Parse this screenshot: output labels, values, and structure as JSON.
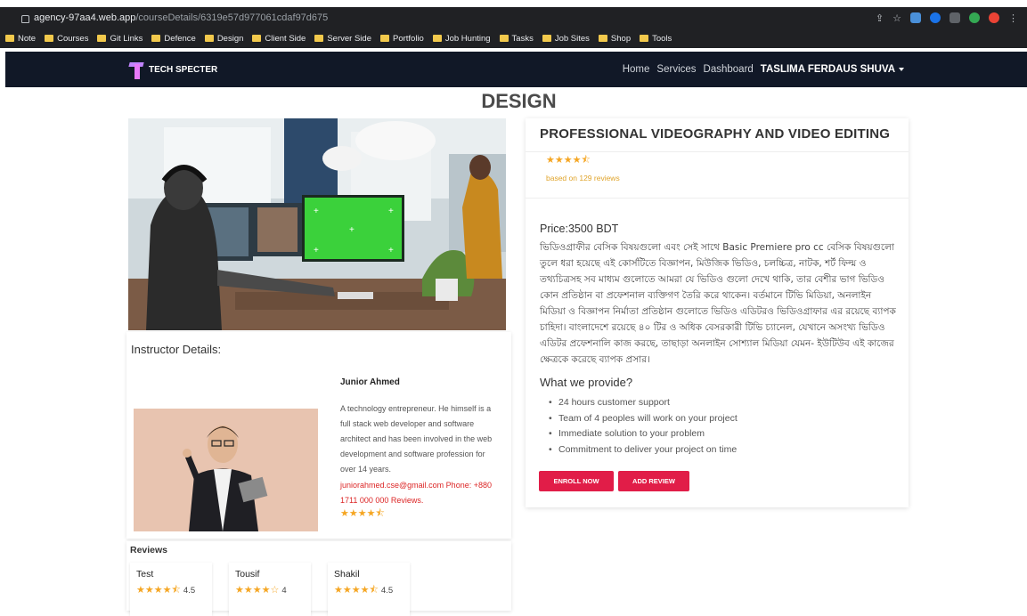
{
  "browser": {
    "url_host": "agency-97aa4.web.app",
    "url_path": "/courseDetails/6319e57d977061cdaf97d675",
    "bookmarks": [
      "Note",
      "Courses",
      "Git Links",
      "Defence",
      "Design",
      "Client Side",
      "Server Side",
      "Portfolio",
      "Job Hunting",
      "Tasks",
      "Job Sites",
      "Shop",
      "Tools"
    ]
  },
  "navbar": {
    "brand": "TECH SPECTER",
    "links": [
      "Home",
      "Services",
      "Dashboard"
    ],
    "user": "TASLIMA FERDAUS SHUVA"
  },
  "page": {
    "title": "DESIGN"
  },
  "instructor": {
    "heading": "Instructor Details:",
    "name": "Junior Ahmed",
    "bio": "A technology entrepreneur. He himself is a full stack web developer and software architect and has been involved in the web development and software profession for over 14 years.",
    "contact": "juniorahmed.cse@gmail.com Phone: +880 1711 000 000 Reviews.",
    "rating": 4.5
  },
  "reviews": {
    "heading": "Reviews",
    "items": [
      {
        "name": "Test",
        "rating": 4.5,
        "rating_text": "4.5"
      },
      {
        "name": "Tousif",
        "rating": 4,
        "rating_text": "4"
      },
      {
        "name": "Shakil",
        "rating": 4.5,
        "rating_text": "4.5"
      }
    ]
  },
  "course": {
    "title": "PROFESSIONAL VIDEOGRAPHY AND VIDEO EDITING",
    "rating": 4.5,
    "reviews_count": "based on 129 reviews",
    "price": "Price:3500 BDT",
    "description": "ভিডিওগ্রাফীর বেসিক বিষয়গুলো এবং সেই সাথে Basic Premiere pro cc বেসিক বিষয়গুলো তুলে ধরা হয়েছে এই কোর্সটিতে বিজ্ঞাপন, মিউজিক ভিডিও, চলচ্চিত্র, নাটক, শর্ট ফিল্ম ও তথ্যচিত্রসহ সব মাধ্যম গুলোতে আমরা যে ভিডিও গুলো দেখে থাকি, তার বেশীর ভাগ ভিডিও কোন প্রতিষ্ঠান বা প্রফেশনাল ব্যক্তিগণ তৈরি করে থাকেন। বর্তমানে টিভি মিডিয়া, অনলাইন মিডিয়া ও বিজ্ঞাপন নির্মাতা প্রতিষ্ঠান গুলোতে ভিডিও এডিটরও ভিডিওগ্রাফার এর রয়েছে ব্যাপক চাহিদা। বাংলাদেশে রয়েছে ৪০ টির ও অধিক বেসরকারী টিভি চ্যানেল, যেখানে অসংখ্য ভিডিও এডিটর প্রফেশনালি কাজ করছে, তাছাড়া অনলাইন সোশ্যাল মিডিয়া যেমন- ইউটিউব এই কাজের ক্ষেত্রকে করেছে ব্যাপক প্রসার।",
    "provide_heading": "What we provide?",
    "provide_items": [
      "24 hours customer support",
      "Team of 4 peoples will work on your project",
      "Immediate solution to your problem",
      "Commitment to deliver your project on time"
    ],
    "enroll_label": "ENROLL NOW",
    "review_label": "ADD REVIEW"
  },
  "colors": {
    "navbar_bg": "#111827",
    "accent_red": "#e11d48",
    "star": "#f5a623",
    "contact_red": "#dc2626"
  }
}
